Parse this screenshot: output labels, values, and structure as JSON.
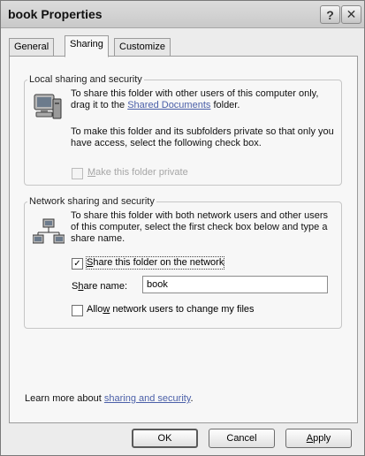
{
  "window": {
    "title": "book Properties"
  },
  "titlebar": {
    "help_glyph": "?",
    "close_glyph": "✕"
  },
  "tabs": [
    {
      "label": "General",
      "active": false
    },
    {
      "label": "Sharing",
      "active": true
    },
    {
      "label": "Customize",
      "active": false
    }
  ],
  "local": {
    "legend": "Local sharing and security",
    "text1_prefix": "To share this folder with other users of this computer only, drag it to the ",
    "text1_link": "Shared Documents",
    "text1_suffix": " folder.",
    "text2": "To make this folder and its subfolders private so that only you have access, select the following check box.",
    "private_checkbox": {
      "label_accel": "M",
      "label_rest": "ake this folder private",
      "checked": false,
      "enabled": false
    }
  },
  "network": {
    "legend": "Network sharing and security",
    "text": "To share this folder with both network users and other users of this computer, select the first check box below and type a share name.",
    "share_checkbox": {
      "label_accel": "S",
      "label_rest": "hare this folder on the network",
      "checked": true
    },
    "share_name_label_pre": "S",
    "share_name_label_accel": "h",
    "share_name_label_post": "are name:",
    "share_name_value": "book",
    "allow_checkbox": {
      "label_pre": "Allo",
      "label_accel": "w",
      "label_rest": " network users to change my files",
      "checked": false
    }
  },
  "footer": {
    "learn_prefix": "Learn more about ",
    "learn_link": "sharing and security",
    "learn_suffix": "."
  },
  "buttons": {
    "ok": "OK",
    "cancel": "Cancel",
    "apply_accel": "A",
    "apply_rest": "pply"
  }
}
